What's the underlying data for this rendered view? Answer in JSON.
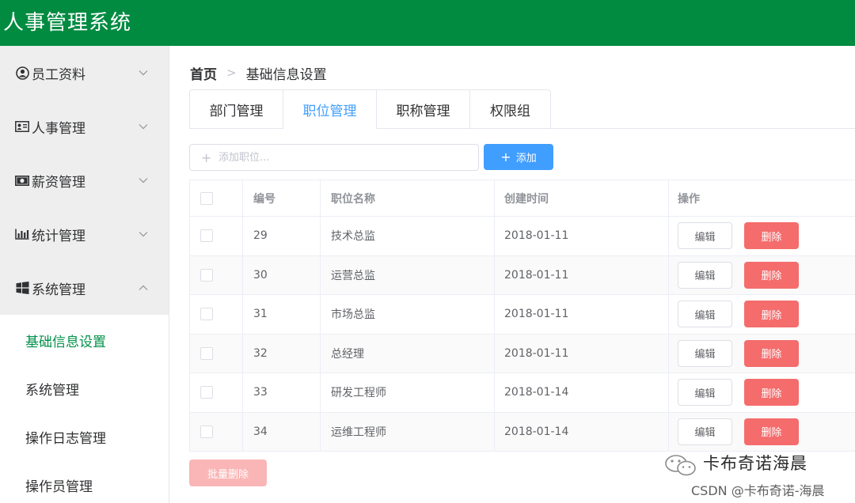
{
  "header": {
    "title": "人事管理系统"
  },
  "sidebar": {
    "groups": [
      {
        "label": "员工资料",
        "icon": "user-circle-icon",
        "expanded": false
      },
      {
        "label": "人事管理",
        "icon": "id-card-icon",
        "expanded": false
      },
      {
        "label": "薪资管理",
        "icon": "money-icon",
        "expanded": false
      },
      {
        "label": "统计管理",
        "icon": "bar-chart-icon",
        "expanded": false
      },
      {
        "label": "系统管理",
        "icon": "windows-icon",
        "expanded": true
      }
    ],
    "sub_items": [
      {
        "label": "基础信息设置",
        "active": true
      },
      {
        "label": "系统管理",
        "active": false
      },
      {
        "label": "操作日志管理",
        "active": false
      },
      {
        "label": "操作员管理",
        "active": false
      }
    ]
  },
  "breadcrumb": {
    "home": "首页",
    "current": "基础信息设置"
  },
  "tabs": [
    {
      "label": "部门管理",
      "active": false
    },
    {
      "label": "职位管理",
      "active": true
    },
    {
      "label": "职称管理",
      "active": false
    },
    {
      "label": "权限组",
      "active": false
    }
  ],
  "add_position": {
    "placeholder": "添加职位...",
    "button_label": "添加"
  },
  "table": {
    "headers": {
      "id": "编号",
      "name": "职位名称",
      "created": "创建时间",
      "ops": "操作"
    },
    "rows": [
      {
        "id": "29",
        "name": "技术总监",
        "created": "2018-01-11"
      },
      {
        "id": "30",
        "name": "运营总监",
        "created": "2018-01-11"
      },
      {
        "id": "31",
        "name": "市场总监",
        "created": "2018-01-11"
      },
      {
        "id": "32",
        "name": "总经理",
        "created": "2018-01-11"
      },
      {
        "id": "33",
        "name": "研发工程师",
        "created": "2018-01-14"
      },
      {
        "id": "34",
        "name": "运维工程师",
        "created": "2018-01-14"
      }
    ],
    "edit_label": "编辑",
    "delete_label": "删除"
  },
  "batch_delete_label": "批量删除",
  "watermark": {
    "name": "卡布奇诺海晨",
    "csdn": "CSDN @卡布奇诺-海晨"
  },
  "colors": {
    "header_bg": "#008b41",
    "accent": "#409eff",
    "danger": "#f56c6c",
    "active_menu": "#00914a"
  }
}
